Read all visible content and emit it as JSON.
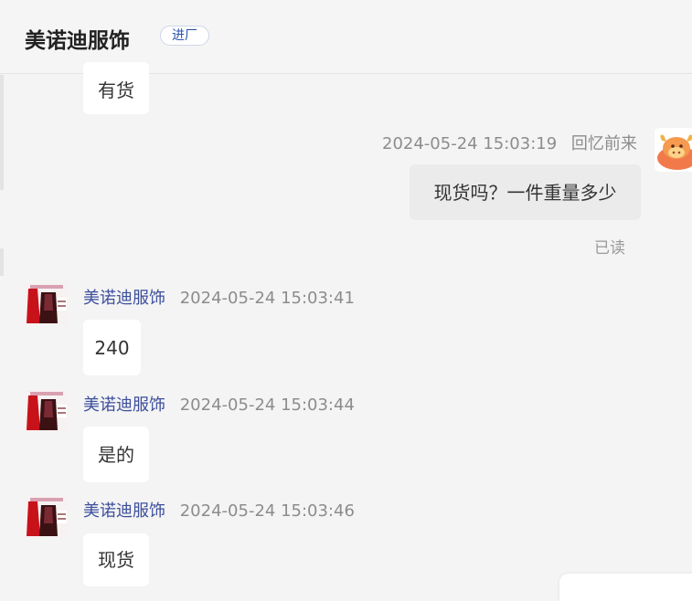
{
  "header": {
    "title": "美诺迪服饰",
    "badge": "进厂"
  },
  "messages": {
    "m0": {
      "text": "有货"
    },
    "m1": {
      "time": "2024-05-24 15:03:19",
      "sender": "回忆前来",
      "text": "现货吗？一件重量多少",
      "status": "已读"
    },
    "m2": {
      "sender": "美诺迪服饰",
      "time": "2024-05-24 15:03:41",
      "text": "240"
    },
    "m3": {
      "sender": "美诺迪服饰",
      "time": "2024-05-24 15:03:44",
      "text": "是的"
    },
    "m4": {
      "sender": "美诺迪服饰",
      "time": "2024-05-24 15:03:46",
      "text": "现货"
    }
  },
  "icons": {
    "shop_avatar": "shop-logo-avatar",
    "user_avatar": "cow-cartoon-avatar"
  },
  "colors": {
    "sender_name": "#3d4f9c",
    "badge_text": "#2a55b0",
    "background": "#f4f4f4"
  }
}
